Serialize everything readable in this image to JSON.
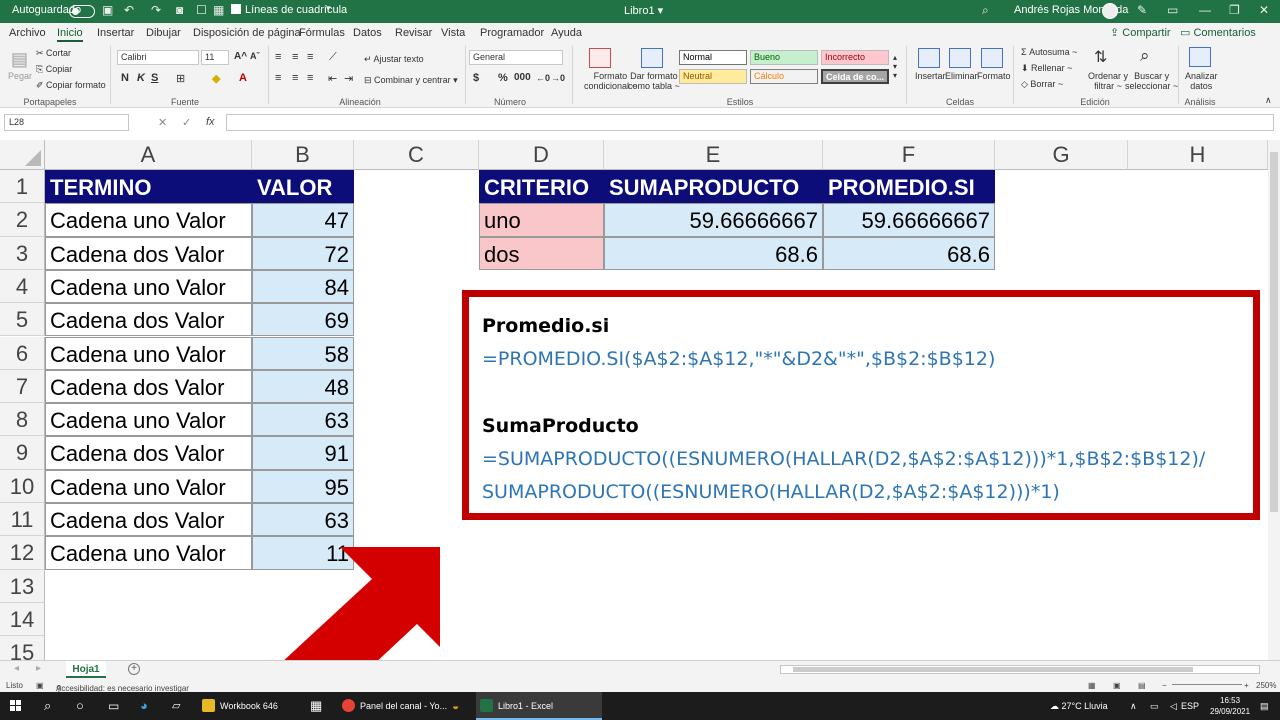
{
  "titlebar": {
    "autosave": "Autoguardado",
    "gridlines": "Líneas de cuadrícula",
    "doc_title": "Libro1 ▾",
    "user": "Andrés Rojas Moncada"
  },
  "menu": {
    "tabs": [
      "Archivo",
      "Inicio",
      "Insertar",
      "Dibujar",
      "Disposición de página",
      "Fórmulas",
      "Datos",
      "Revisar",
      "Vista",
      "Programador",
      "Ayuda"
    ],
    "share": "Compartir",
    "comments": "Comentarios"
  },
  "ribbon": {
    "clipboard": {
      "paste": "Pegar",
      "cut": "Cortar",
      "copy": "Copiar",
      "format_painter": "Copiar formato",
      "label": "Portapapeles"
    },
    "font": {
      "name": "Calibri",
      "size": "11",
      "bold": "N",
      "italic": "K",
      "underline": "S",
      "label": "Fuente"
    },
    "alignment": {
      "wrap": "Ajustar texto",
      "merge": "Combinar y centrar",
      "label": "Alineación"
    },
    "number": {
      "format": "General",
      "label": "Número"
    },
    "styles": {
      "cond_format_1": "Formato",
      "cond_format_2": "condicional ~",
      "table_format_1": "Dar formato",
      "table_format_2": "como tabla ~",
      "normal": "Normal",
      "bueno": "Bueno",
      "incorrecto": "Incorrecto",
      "neutral": "Neutral",
      "calculo": "Cálculo",
      "celda": "Celda de co...",
      "label": "Estilos"
    },
    "cells": {
      "insert": "Insertar",
      "delete": "Eliminar",
      "format": "Formato",
      "label": "Celdas"
    },
    "editing": {
      "autosum": "Autosuma ~",
      "fill": "Rellenar ~",
      "clear": "Borrar ~",
      "sort_1": "Ordenar y",
      "sort_2": "filtrar ~",
      "find_1": "Buscar y",
      "find_2": "seleccionar ~",
      "label": "Edición"
    },
    "analysis": {
      "analyze_1": "Analizar",
      "analyze_2": "datos",
      "label": "Análisis"
    }
  },
  "formulabar": {
    "namebox": "L28",
    "fx": "fx",
    "value": ""
  },
  "columns": [
    "A",
    "B",
    "C",
    "D",
    "E",
    "F",
    "G",
    "H"
  ],
  "rows": [
    "1",
    "2",
    "3",
    "4",
    "5",
    "6",
    "7",
    "8",
    "9",
    "10",
    "11",
    "12",
    "13",
    "14",
    "15"
  ],
  "table1": {
    "headers": [
      "TERMINO",
      "VALOR"
    ],
    "terms": [
      "Cadena uno Valor",
      "Cadena dos Valor",
      "Cadena uno Valor",
      "Cadena dos Valor",
      "Cadena uno Valor",
      "Cadena dos Valor",
      "Cadena uno Valor",
      "Cadena dos Valor",
      "Cadena uno Valor",
      "Cadena dos Valor",
      "Cadena uno Valor"
    ],
    "values": [
      "47",
      "72",
      "84",
      "69",
      "58",
      "48",
      "63",
      "91",
      "95",
      "63",
      "11"
    ]
  },
  "table2": {
    "headers": [
      "CRITERIO",
      "SUMAPRODUCTO",
      "PROMEDIO.SI"
    ],
    "rows": [
      {
        "criterio": "uno",
        "sumaproducto": "59.66666667",
        "promedio": "59.66666667"
      },
      {
        "criterio": "dos",
        "sumaproducto": "68.6",
        "promedio": "68.6"
      }
    ]
  },
  "formula_box": {
    "title1": "Promedio.si",
    "formula1": "=PROMEDIO.SI($A$2:$A$12,\"*\"&D2&\"*\",$B$2:$B$12)",
    "title2": "SumaProducto",
    "formula2a": "=SUMAPRODUCTO((ESNUMERO(HALLAR(D2,$A$2:$A$12)))*1,$B$2:$B$12)/",
    "formula2b": "SUMAPRODUCTO((ESNUMERO(HALLAR(D2,$A$2:$A$12)))*1)"
  },
  "sheet_tab": "Hoja1",
  "status": {
    "ready": "Listo",
    "accessibility": "Accesibilidad: es necesario investigar",
    "zoom": "250%"
  },
  "taskbar": {
    "workbook": "Workbook 646",
    "chrome": "Panel del canal - Yo...",
    "excel": "Libro1 - Excel",
    "weather": "27°C  Lluvia",
    "lang": "ESP",
    "time": "16:53",
    "date": "29/09/2021"
  },
  "colors": {
    "excel_green": "#217346",
    "header_navy": "#0d0d7a",
    "value_blue": "#d6eaf8",
    "criterio_pink": "#f9c6c9",
    "box_red": "#c00000",
    "arrow_red": "#d40000",
    "formula_blue": "#2e75b6"
  }
}
